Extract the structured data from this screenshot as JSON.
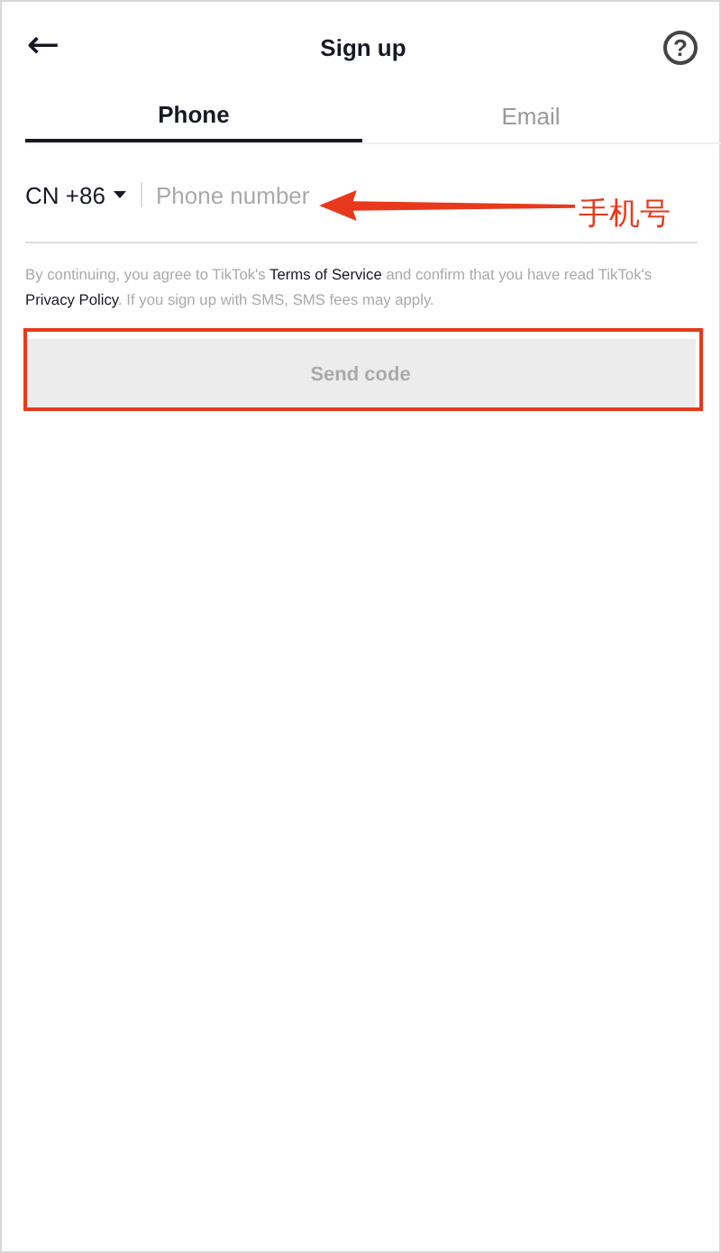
{
  "header": {
    "back": "←",
    "title": "Sign up",
    "help": "?"
  },
  "tabs": [
    {
      "label": "Phone",
      "selected": true
    },
    {
      "label": "Email",
      "selected": false
    }
  ],
  "phone": {
    "country_code": "CN +86",
    "placeholder": "Phone number"
  },
  "consent": {
    "before": "By continuing, you agree to TikTok's ",
    "terms_link": "Terms of Service",
    "middle": " and confirm that you have read TikTok's ",
    "privacy_link": "Privacy Policy",
    "after": ". If you sign up with SMS, SMS fees may apply."
  },
  "send_button": {
    "label": "Send code",
    "disabled": true
  },
  "annotations": [
    {
      "kind": "arrow_label",
      "text": "手机号"
    },
    {
      "kind": "frame"
    }
  ]
}
